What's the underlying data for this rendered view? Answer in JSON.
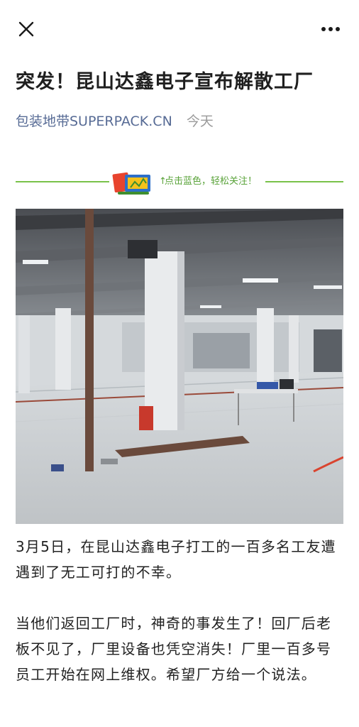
{
  "topbar": {
    "close_icon": "close-icon",
    "more_icon": "more-dots-icon"
  },
  "article": {
    "title": "突发！昆山达鑫电子宣布解散工厂",
    "account": "包装地带SUPERPACK.CN",
    "date": "今天",
    "follow_text": "点击蓝色，轻松关注！",
    "follow_arrow": "↑",
    "paragraphs": [
      "3月5日，在昆山达鑫电子打工的一百多名工友遭遇到了无工可打的不幸。",
      "当他们返回工厂时，神奇的事发生了！回厂后老板不见了，厂里设备也凭空消失！厂里一百多号员工开始在网上维权。希望厂方给一个说法。"
    ]
  },
  "colors": {
    "link": "#576b95",
    "follow_green": "#79c24a"
  }
}
